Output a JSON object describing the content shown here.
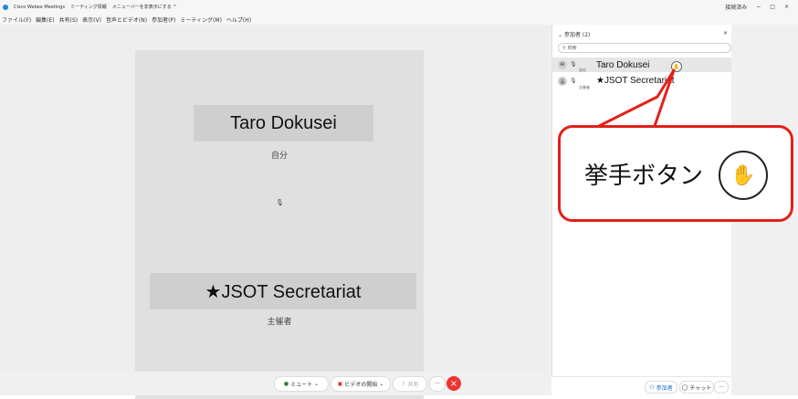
{
  "titlebar": {
    "app_name": "Cisco Webex Meetings",
    "meeting_info": "ミーティング情報",
    "menu_hide": "メニューバーを非表示にする ^",
    "status": "接続済み",
    "minimize": "−",
    "maximize": "□",
    "close": "×"
  },
  "menubar": {
    "items": [
      "ファイル(F)",
      "編集(E)",
      "共有(S)",
      "表示(V)",
      "音声とビデオ(N)",
      "参加者(P)",
      "ミーティング(M)",
      "ヘルプ(H)"
    ]
  },
  "stage": {
    "top_tile": {
      "name": "Taro Dokusei",
      "subtitle": "自分",
      "mic_icon": "🎙"
    },
    "bottom_tile": {
      "name": "★JSOT Secretariat",
      "subtitle": "主催者",
      "mic_icon": "🎙"
    }
  },
  "toolbar": {
    "mute_label": "ミュート",
    "video_label": "ビデオの開始",
    "share_label": "共有",
    "more_label": "···",
    "end_label": "×"
  },
  "panel": {
    "title": "参加者 (2)",
    "close": "×",
    "search_placeholder": "検索",
    "participants": [
      {
        "avatar": "AI",
        "name": "Taro Dokusei",
        "role": "自分",
        "selected": true
      },
      {
        "avatar": "品",
        "name": "★JSOT Secretariat",
        "role": "主催者",
        "selected": false
      }
    ],
    "footer": {
      "participants_button": "参加者",
      "chat_button": "チャット",
      "more": "···"
    }
  },
  "callout": {
    "label": "挙手ボタン",
    "icon": "hand-raise-icon"
  },
  "colors": {
    "callout_red": "#e2201b",
    "end_button": "#e33333",
    "stage_bg": "#e0e0e0"
  }
}
